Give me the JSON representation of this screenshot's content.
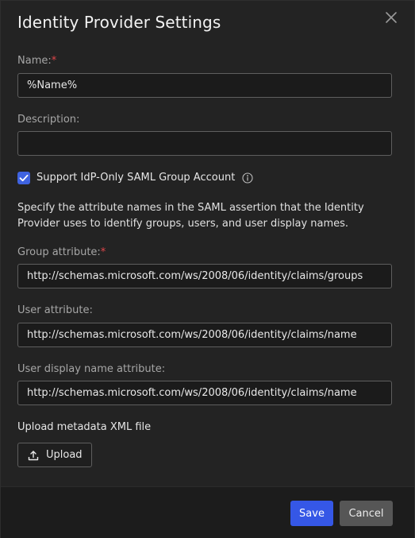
{
  "dialog": {
    "title": "Identity Provider Settings"
  },
  "form": {
    "required_marker": "*",
    "name": {
      "label": "Name:",
      "value": "%Name%"
    },
    "description": {
      "label": "Description:",
      "value": ""
    },
    "support_group_account": {
      "label": "Support IdP-Only SAML Group Account",
      "checked": true
    },
    "instructions": "Specify the attribute names in the SAML assertion that the Identity Provider uses to identify groups, users, and user display names.",
    "group_attribute": {
      "label": "Group attribute:",
      "value": "http://schemas.microsoft.com/ws/2008/06/identity/claims/groups"
    },
    "user_attribute": {
      "label": "User attribute:",
      "value": "http://schemas.microsoft.com/ws/2008/06/identity/claims/name"
    },
    "user_display_name_attribute": {
      "label": "User display name attribute:",
      "value": "http://schemas.microsoft.com/ws/2008/06/identity/claims/name"
    },
    "upload": {
      "heading": "Upload metadata XML file",
      "button_label": "Upload"
    }
  },
  "footer": {
    "save_label": "Save",
    "cancel_label": "Cancel"
  },
  "icons": {
    "close": "close-icon",
    "info": "info-icon",
    "upload": "upload-icon",
    "check": "checkmark-icon"
  },
  "colors": {
    "background": "#232323",
    "footer_background": "#1c1c1c",
    "accent": "#3557e6",
    "checkbox": "#3f63e0",
    "required": "#e0464a",
    "cancel_button": "#565656"
  }
}
